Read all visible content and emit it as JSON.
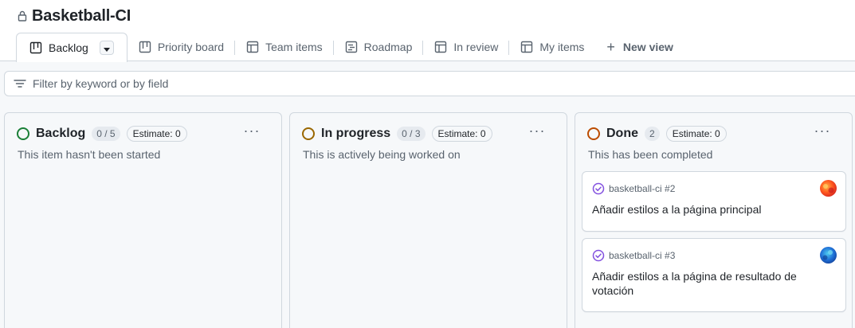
{
  "project": {
    "title": "Basketball-CI"
  },
  "tabs": [
    {
      "label": "Backlog",
      "icon": "board-icon",
      "active": true
    },
    {
      "label": "Priority board",
      "icon": "board-icon"
    },
    {
      "label": "Team items",
      "icon": "table-icon"
    },
    {
      "label": "Roadmap",
      "icon": "roadmap-icon"
    },
    {
      "label": "In review",
      "icon": "table-icon"
    },
    {
      "label": "My items",
      "icon": "table-icon"
    }
  ],
  "new_view": {
    "label": "New view",
    "icon": "plus-icon"
  },
  "filter": {
    "placeholder": "Filter by keyword or by field",
    "icon": "filter-icon"
  },
  "colors": {
    "backlog": "#1a7f37",
    "in_progress": "#9a6700",
    "done": "#bc4c00",
    "card_icon": "#8250df"
  },
  "columns": [
    {
      "name": "Backlog",
      "count": "0 / 5",
      "estimate": "Estimate: 0",
      "description": "This item hasn't been started",
      "more": "···",
      "cards": []
    },
    {
      "name": "In progress",
      "count": "0 / 3",
      "estimate": "Estimate: 0",
      "description": "This is actively being worked on",
      "more": "···",
      "cards": []
    },
    {
      "name": "Done",
      "count": "2",
      "estimate": "Estimate: 0",
      "description": "This has been completed",
      "more": "···",
      "cards": [
        {
          "ref": "basketball-ci #2",
          "title": "Añadir estilos a la página principal",
          "icon": "issue-closed-icon"
        },
        {
          "ref": "basketball-ci #3",
          "title": "Añadir estilos a la página de resultado de votación",
          "icon": "issue-closed-icon"
        }
      ]
    }
  ]
}
